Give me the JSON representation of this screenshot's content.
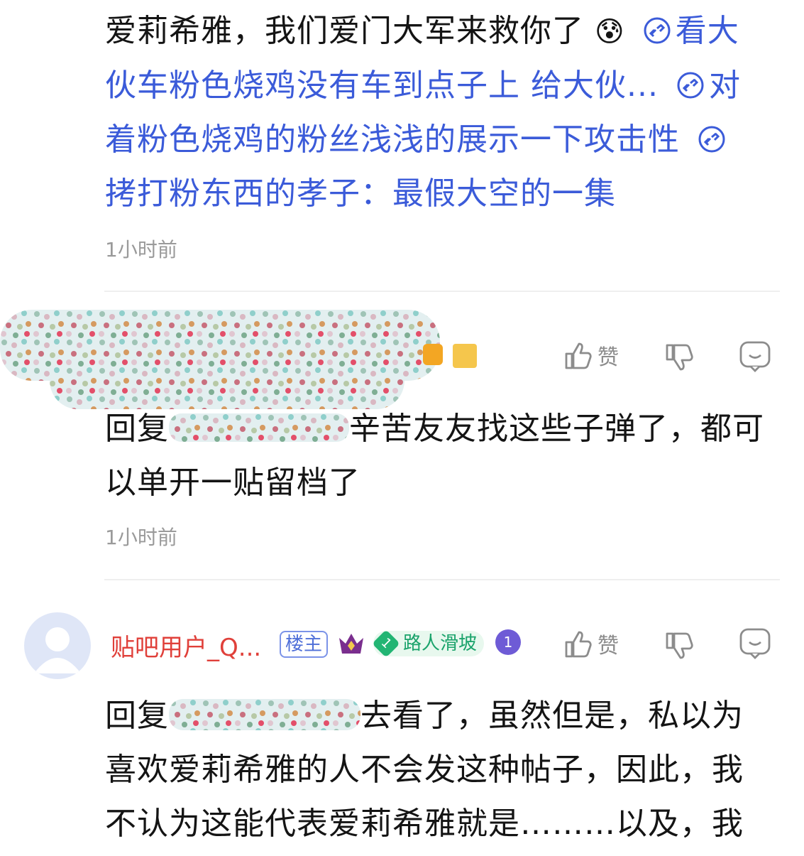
{
  "comment1": {
    "text_start": "爱莉希雅，我们爱门大军来救你了",
    "emoji": "😰",
    "link1_part1": "看大",
    "link1_part2": "伙车粉色烧鸡没有车到点子上 给大伙...",
    "link2_part1": "对",
    "link2_part2": "着粉色烧鸡的粉丝浅浅的展示一下攻击性",
    "link3": "拷打粉东西的孝子：最假大空的一集",
    "time": "1小时前"
  },
  "comment2": {
    "reply_prefix": "回复",
    "text_after_mask": "辛苦友友找这些子弹了，都可",
    "text_line2": "以单开一贴留档了",
    "time": "1小时前",
    "like_label": "赞"
  },
  "comment3": {
    "username": "贴吧用户_Q...",
    "badge_owner": "楼主",
    "level_number": "1",
    "level_name": "路人滑坡",
    "medal_number": "1",
    "like_label": "赞",
    "reply_prefix": "回复",
    "text_after_mask": "去看了，虽然但是，私以为",
    "text_line2": "喜欢爱莉希雅的人不会发这种帖子，因此，我",
    "text_line3": "不认为这能代表爱莉希雅就是………以及，我"
  },
  "colors": {
    "link": "#3b5bd9",
    "username": "#e0403a",
    "time": "#9a9a9a",
    "level_green": "#1aa36b"
  }
}
